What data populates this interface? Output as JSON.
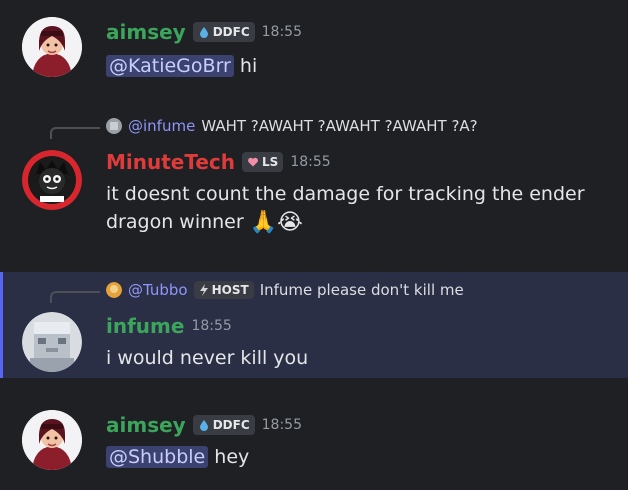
{
  "messages": [
    {
      "username": "aimsey",
      "username_color": "#3ba55c",
      "tag": "DDFC",
      "time": "18:55",
      "mention": "@KatieGoBrr",
      "text": "hi"
    },
    {
      "reply_to": {
        "name": "@infume",
        "text": "WAHT ?AWAHT ?AWAHT ?AWAHT ?A?"
      },
      "username": "MinuteTech",
      "username_color": "#e03b3b",
      "tag": "LS",
      "time": "18:55",
      "text": "it doesnt count the damage for tracking the ender dragon winner"
    },
    {
      "highlighted": true,
      "reply_to": {
        "name": "@Tubbo",
        "tag": "HOST",
        "text": "Infume please don't kill me"
      },
      "username": "infume",
      "username_color": "#3ba55c",
      "time": "18:55",
      "text": "i would never kill you"
    },
    {
      "username": "aimsey",
      "username_color": "#3ba55c",
      "tag": "DDFC",
      "time": "18:55",
      "mention": "@Shubble",
      "text": "hey"
    }
  ],
  "colors": {
    "background": "#1f2024",
    "highlight_bg": "#2b2f46",
    "highlight_border": "#5865f2",
    "mention_bg": "#3c4270",
    "mention_text": "#c9cdfb",
    "timestamp": "#949ba4"
  },
  "icons": {
    "tag_ddfc": "water-drop-icon",
    "tag_ls": "heart-icon",
    "tag_host": "lightning-icon",
    "emoji_1": "folded-hands-emoji",
    "emoji_2": "loudly-crying-face-emoji"
  }
}
